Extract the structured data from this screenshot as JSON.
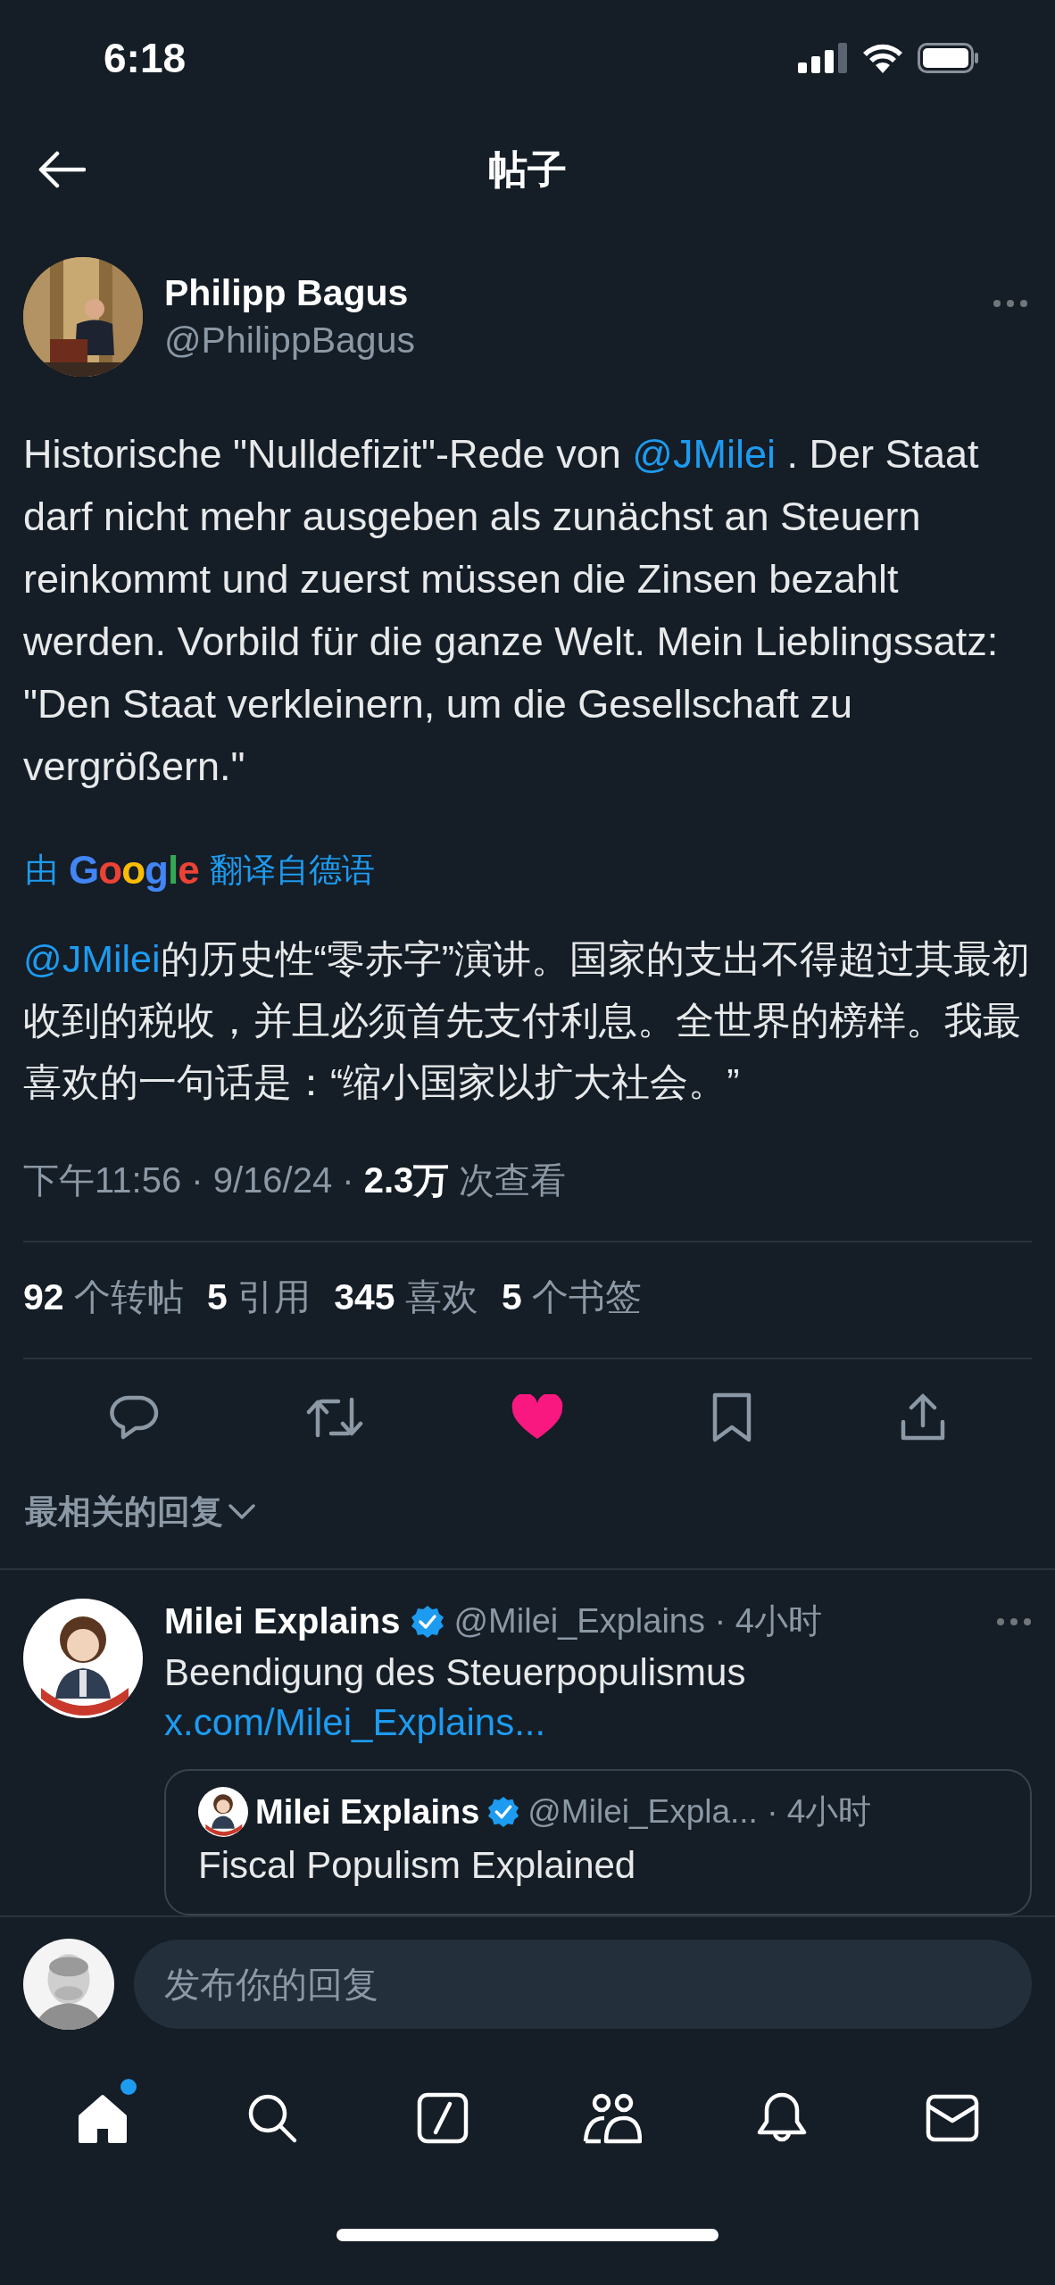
{
  "status_bar": {
    "time": "6:18"
  },
  "header": {
    "title": "帖子"
  },
  "post": {
    "author": {
      "name": "Philipp Bagus",
      "handle": "@PhilippBagus"
    },
    "text": [
      {
        "kind": "text",
        "text": "Historische \"Nulldefizit\"-Rede von "
      },
      {
        "kind": "mention",
        "text": "@JMilei"
      },
      {
        "kind": "text",
        "text": " . Der Staat darf nicht mehr ausgeben als zunächst an Steuern reinkommt und zuerst müssen die Zinsen bezahlt werden. Vorbild für die ganze Welt. Mein Lieblingssatz: \"Den Staat verkleinern, um die Gesellschaft zu vergrößern.\""
      }
    ],
    "translation_label": {
      "prefix": "由",
      "brand": "Google",
      "link": "翻译自德语"
    },
    "translation": [
      {
        "kind": "mention",
        "text": "@JMilei"
      },
      {
        "kind": "text",
        "text": "的历史性“零赤字”演讲。国家的支出不得超过其最初收到的税收，并且必须首先支付利息。全世界的榜样。我最喜欢的一句话是：“缩小国家以扩大社会。”"
      }
    ],
    "meta": "下午11:56 · 9/16/24 · **2.3万** 次查看",
    "stats": [
      {
        "count": "92",
        "label": "个转帖"
      },
      {
        "count": "5",
        "label": "引用"
      },
      {
        "count": "345",
        "label": "喜欢"
      },
      {
        "count": "5",
        "label": "个书签"
      }
    ],
    "actions": [
      {
        "kind": "reply",
        "on": false
      },
      {
        "kind": "repost",
        "on": false
      },
      {
        "kind": "like",
        "on": true
      },
      {
        "kind": "bookmark",
        "on": false
      },
      {
        "kind": "share",
        "on": false
      }
    ]
  },
  "replies_sort": "最相关的回复",
  "replies": [
    {
      "name": "Milei Explains",
      "verified": true,
      "handle_time": "@Milei_Explains · 4小时",
      "text": "Beendigung des Steuerpopulismus",
      "link": "x.com/Milei_Explains...",
      "quote": {
        "name": "Milei Explains",
        "verified": true,
        "handle_time": "@Milei_Expla... · 4小时",
        "text": "Fiscal Populism Explained"
      }
    }
  ],
  "reply_bar": {
    "placeholder": "发布你的回复"
  },
  "nav": [
    {
      "kind": "home",
      "selected": true,
      "badge": true
    },
    {
      "kind": "search",
      "selected": false,
      "badge": false
    },
    {
      "kind": "grok",
      "selected": false,
      "badge": false
    },
    {
      "kind": "communities",
      "selected": false,
      "badge": false
    },
    {
      "kind": "notifications",
      "selected": false,
      "badge": false
    },
    {
      "kind": "messages",
      "selected": false,
      "badge": false
    }
  ]
}
